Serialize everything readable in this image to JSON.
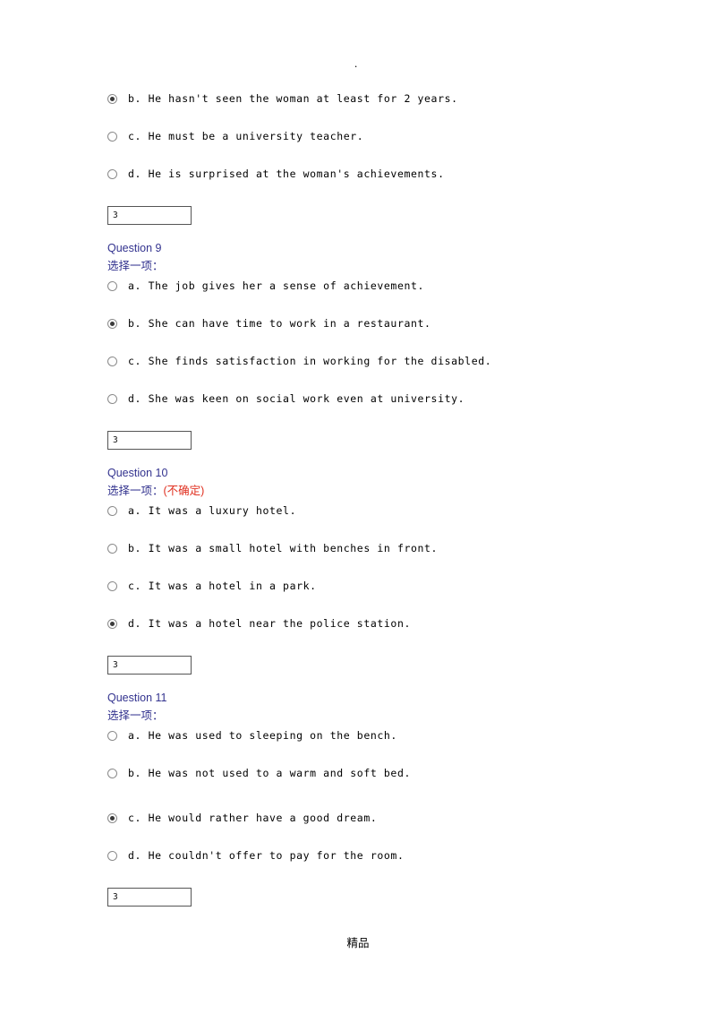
{
  "page": {
    "top_marker": ".",
    "footer": "精品"
  },
  "questions": [
    {
      "title": "",
      "select_label": "",
      "uncertain": "",
      "options": [
        {
          "text": "b. He hasn't seen the woman at least for 2 years.",
          "checked": true
        },
        {
          "text": "c. He must be a university teacher.",
          "checked": false
        },
        {
          "text": "d. He is surprised at the woman's achievements.",
          "checked": false
        }
      ],
      "answer": "3"
    },
    {
      "title": "Question 9",
      "select_label": "选择一项：",
      "uncertain": "",
      "options": [
        {
          "text": "a. The job gives her a sense of achievement.",
          "checked": false
        },
        {
          "text": "b. She can have time to work in a restaurant.",
          "checked": true
        },
        {
          "text": "c. She finds satisfaction in working for the disabled.",
          "checked": false
        },
        {
          "text": "d. She was keen on social work even at university.",
          "checked": false
        }
      ],
      "answer": "3"
    },
    {
      "title": "Question 10",
      "select_label": "选择一项：",
      "uncertain": "(不确定)",
      "options": [
        {
          "text": "a. It was a luxury hotel.",
          "checked": false
        },
        {
          "text": "b. It was a small hotel with benches in front.",
          "checked": false
        },
        {
          "text": "c. It was a hotel in a park.",
          "checked": false
        },
        {
          "text": "d. It was a hotel near the police station.",
          "checked": true
        }
      ],
      "answer": "3"
    },
    {
      "title": "Question 11",
      "select_label": "选择一项：",
      "uncertain": "",
      "options": [
        {
          "text": "a. He was used to sleeping on the bench.",
          "checked": false
        },
        {
          "text": "b. He was not used to a warm and soft bed.",
          "checked": false
        },
        {
          "text": "c. He would rather have a good dream.",
          "checked": true
        },
        {
          "text": "d. He couldn't offer to pay for the room.",
          "checked": false
        }
      ],
      "answer": "3"
    }
  ]
}
